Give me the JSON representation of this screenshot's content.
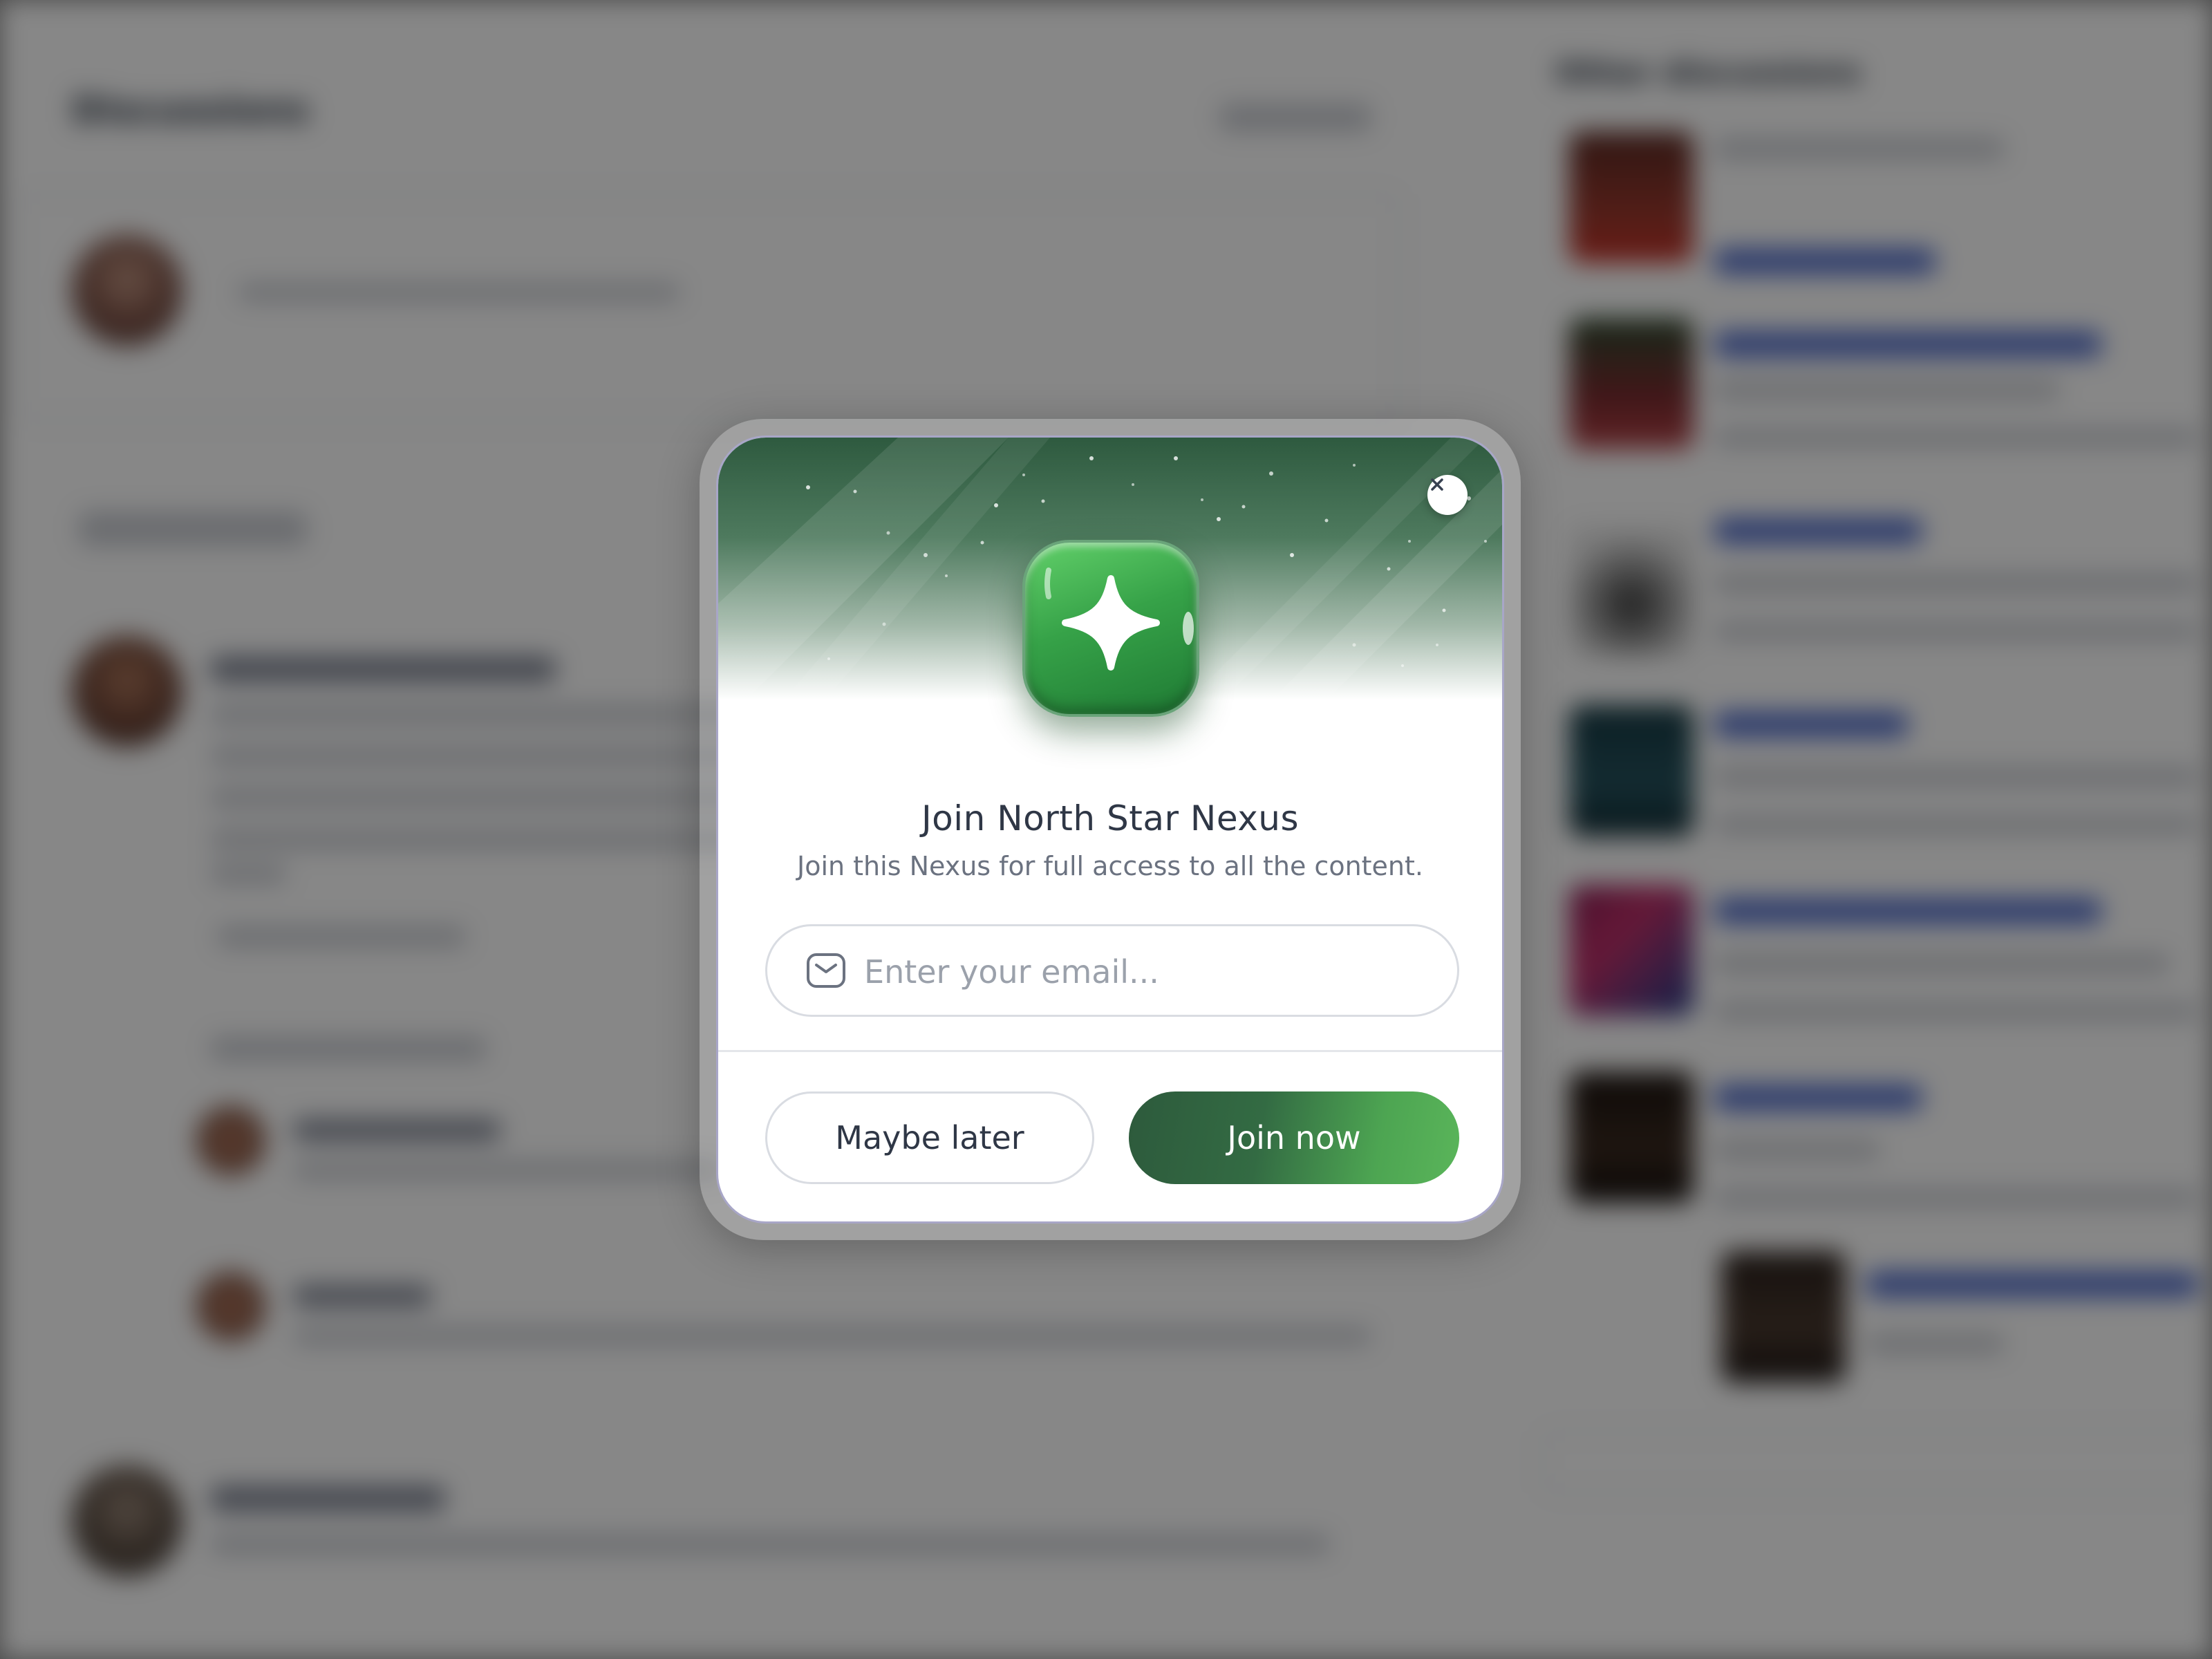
{
  "background": {
    "main_heading": "Discussions",
    "sidebar_heading": "Other discussions"
  },
  "modal": {
    "title": "Join North Star Nexus",
    "subtitle": "Join this Nexus for full access to all the content.",
    "email": {
      "icon": "mail-icon",
      "value": "",
      "placeholder": "Enter your email..."
    },
    "close_icon": "close-icon",
    "app_icon": "sparkle-star-icon",
    "buttons": {
      "secondary_label": "Maybe later",
      "primary_label": "Join now"
    },
    "colors": {
      "brand_green": "#3a8a47",
      "brand_dark_green": "#2d5a3c",
      "text_dark": "#2f3746",
      "text_muted": "#6b7280"
    }
  }
}
